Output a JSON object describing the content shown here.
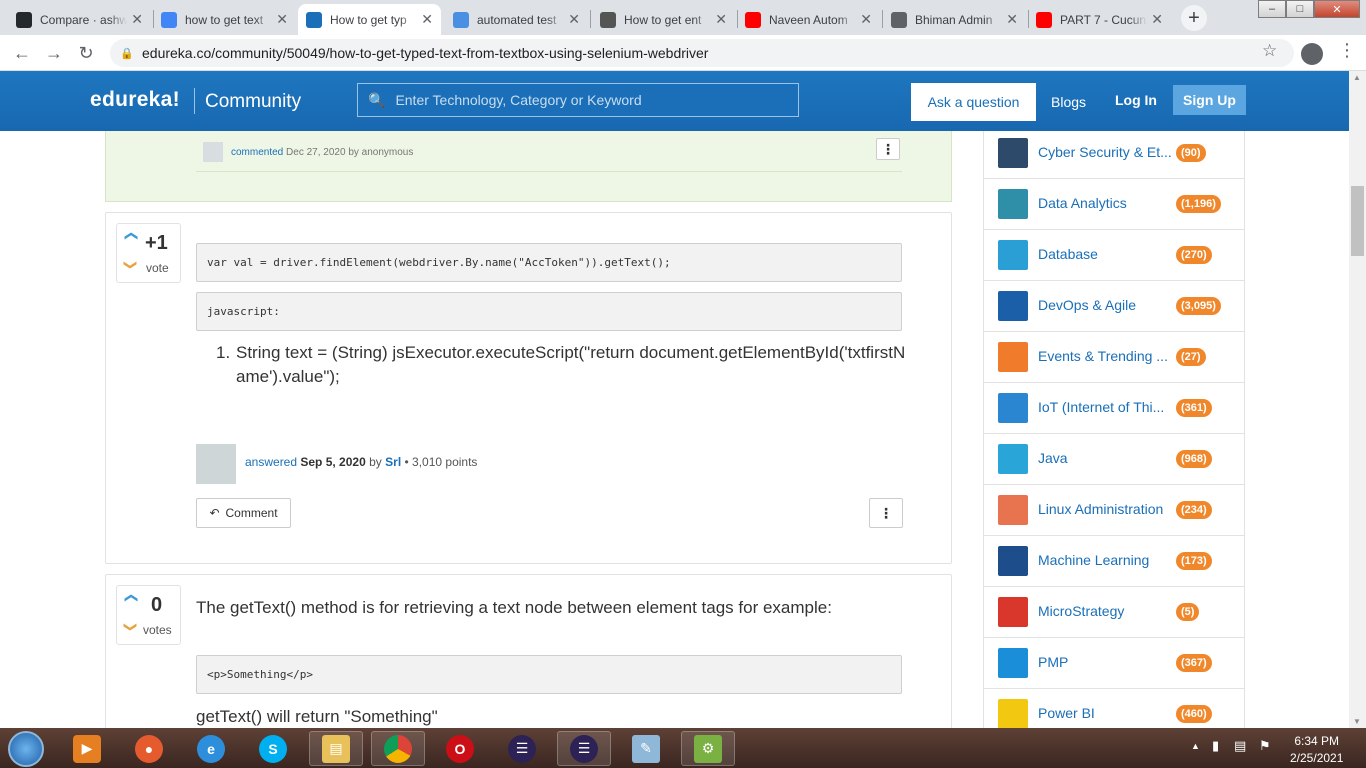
{
  "browser": {
    "tabs": [
      {
        "title": "Compare · ashw",
        "favicon": "github-icon",
        "color": "#24292e",
        "active": false
      },
      {
        "title": "how to get text",
        "favicon": "google-icon",
        "color": "#4285f4",
        "active": false
      },
      {
        "title": "How to get typ",
        "favicon": "edureka-icon",
        "color": "#1a6fb8",
        "active": true
      },
      {
        "title": "automated test",
        "favicon": "qa-icon",
        "color": "#4a90e2",
        "active": false
      },
      {
        "title": "How to get ent",
        "favicon": "diamond-icon",
        "color": "#555555",
        "active": false
      },
      {
        "title": "Naveen Autom",
        "favicon": "youtube-icon",
        "color": "#ff0000",
        "active": false
      },
      {
        "title": "Bhiman Admin",
        "favicon": "globe-icon",
        "color": "#5f6368",
        "active": false
      },
      {
        "title": "PART 7 - Cucun",
        "favicon": "youtube-icon",
        "color": "#ff0000",
        "active": false
      }
    ],
    "url": "edureka.co/community/50049/how-to-get-typed-text-from-textbox-using-selenium-webdriver"
  },
  "header": {
    "logo": "edureka!",
    "section": "Community",
    "search_placeholder": "Enter Technology, Category or Keyword",
    "ask": "Ask a question",
    "blogs": "Blogs",
    "login": "Log In",
    "signup": "Sign Up"
  },
  "prev_comment": {
    "action": "commented",
    "date": "Dec 27, 2020",
    "by": "by anonymous"
  },
  "answer1": {
    "votes": "+1",
    "vote_label": "vote",
    "code1": "var val = driver.findElement(webdriver.By.name(\"AccToken\")).getText();",
    "code2": "javascript:",
    "list_num": "1.",
    "list_text": "String text = (String) jsExecutor.executeScript(\"return document.getElementById('txtfirstName').value\");",
    "meta_action": "answered",
    "meta_date": "Sep 5, 2020",
    "meta_by": "by",
    "meta_user": "Srl",
    "meta_points": "• 3,010 points",
    "comment_btn": "Comment"
  },
  "answer2": {
    "votes": "0",
    "vote_label": "votes",
    "para1": "The getText() method is for retrieving a text node between element tags for example:",
    "code1": "<p>Something</p>",
    "para2": "getText() will return \"Something\""
  },
  "categories": [
    {
      "name": "Cyber Security & Et...",
      "count": "(90)",
      "icon": "cyber-security-icon",
      "color": "#2d4a6b"
    },
    {
      "name": "Data Analytics",
      "count": "(1,196)",
      "icon": "data-analytics-icon",
      "color": "#2f8fa8"
    },
    {
      "name": "Database",
      "count": "(270)",
      "icon": "database-icon",
      "color": "#2a9fd6"
    },
    {
      "name": "DevOps & Agile",
      "count": "(3,095)",
      "icon": "devops-icon",
      "color": "#1b5fa8"
    },
    {
      "name": "Events & Trending ...",
      "count": "(27)",
      "icon": "events-icon",
      "color": "#f07b2b"
    },
    {
      "name": "IoT (Internet of Thi...",
      "count": "(361)",
      "icon": "iot-icon",
      "color": "#2a86d1"
    },
    {
      "name": "Java",
      "count": "(968)",
      "icon": "java-icon",
      "color": "#2aa5d8"
    },
    {
      "name": "Linux Administration",
      "count": "(234)",
      "icon": "linux-icon",
      "color": "#e8734f"
    },
    {
      "name": "Machine Learning",
      "count": "(173)",
      "icon": "machine-learning-icon",
      "color": "#1e4d8c"
    },
    {
      "name": "MicroStrategy",
      "count": "(5)",
      "icon": "microstrategy-icon",
      "color": "#d9362c"
    },
    {
      "name": "PMP",
      "count": "(367)",
      "icon": "pmp-icon",
      "color": "#1a8ed8"
    },
    {
      "name": "Power BI",
      "count": "(460)",
      "icon": "power-bi-icon",
      "color": "#f2c811"
    }
  ],
  "taskbar": {
    "time": "6:34 PM",
    "date": "2/25/2021"
  }
}
